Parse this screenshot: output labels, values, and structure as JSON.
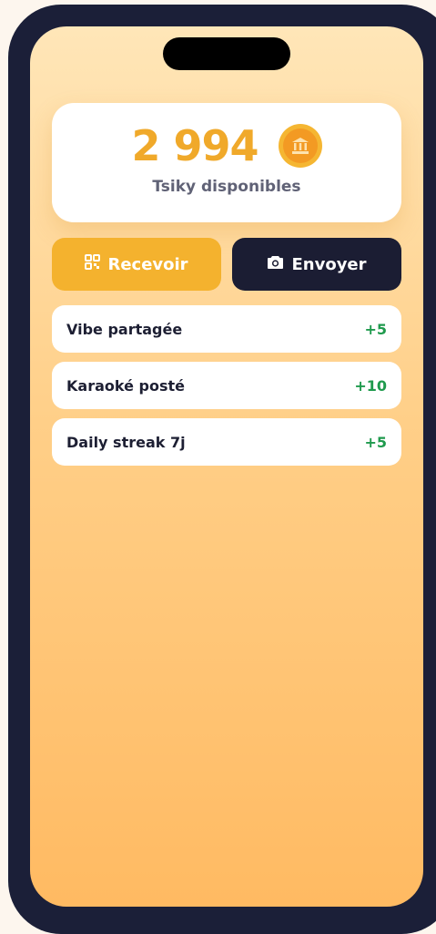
{
  "balance": {
    "amount": "2 994",
    "label": "Tsiky disponibles",
    "coin_icon": "bank-coin-icon"
  },
  "actions": {
    "receive": {
      "label": "Recevoir",
      "icon": "qr-code-icon",
      "color": "#f4b22e"
    },
    "send": {
      "label": "Envoyer",
      "icon": "camera-icon",
      "color": "#1b1d33"
    }
  },
  "transactions": [
    {
      "label": "Vibe partagée",
      "value": "+5"
    },
    {
      "label": "Karaoké posté",
      "value": "+10"
    },
    {
      "label": "Daily streak 7j",
      "value": "+5"
    }
  ],
  "colors": {
    "accent": "#f0a92a",
    "positive": "#1f9a4d",
    "dark": "#1b1d33"
  }
}
